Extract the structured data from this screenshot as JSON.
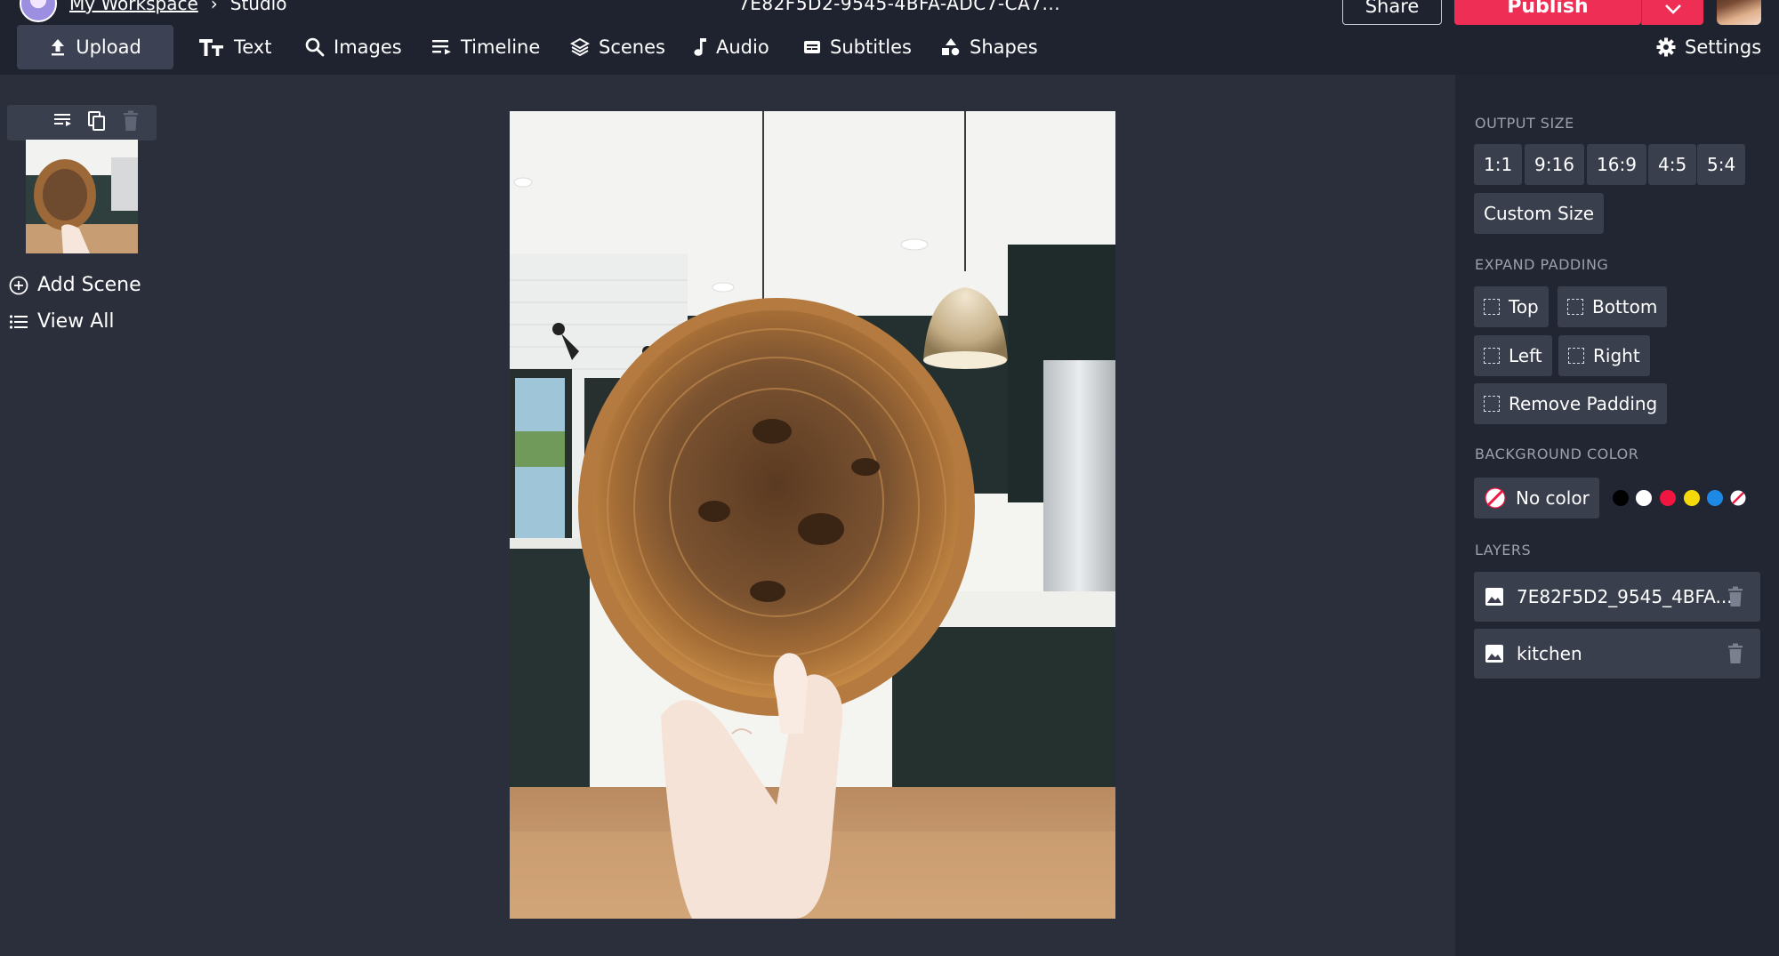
{
  "header": {
    "workspace_link": "My Workspace",
    "breadcrumb_sep": "›",
    "breadcrumb_current": "Studio",
    "document_title": "7E82F5D2-9545-4BFA-ADC7-CA7...",
    "share_label": "Share",
    "publish_label": "Publish"
  },
  "toolbar": {
    "upload": "Upload",
    "text": "Text",
    "images": "Images",
    "timeline": "Timeline",
    "scenes": "Scenes",
    "audio": "Audio",
    "subtitles": "Subtitles",
    "shapes": "Shapes",
    "settings": "Settings"
  },
  "scenes_panel": {
    "add_scene": "Add Scene",
    "view_all": "View All"
  },
  "right_panel": {
    "output_size_label": "OUTPUT SIZE",
    "output_sizes": [
      "1:1",
      "9:16",
      "16:9",
      "4:5",
      "5:4"
    ],
    "custom_size": "Custom Size",
    "expand_padding_label": "EXPAND PADDING",
    "padding": {
      "top": "Top",
      "bottom": "Bottom",
      "left": "Left",
      "right": "Right",
      "remove": "Remove Padding"
    },
    "background_color_label": "BACKGROUND COLOR",
    "no_color": "No color",
    "swatches": [
      "#000000",
      "#ffffff",
      "#f0163f",
      "#f5d90a",
      "#1e88e5"
    ],
    "layers_label": "LAYERS",
    "layers": [
      "7E82F5D2_9545_4BFA...",
      "kitchen"
    ]
  },
  "colors": {
    "accent": "#ef2e55",
    "header_bg": "#1f2330",
    "workspace_bg": "#2b2f3b",
    "panel_bg": "#222632",
    "button_bg": "#3a3f4e"
  }
}
